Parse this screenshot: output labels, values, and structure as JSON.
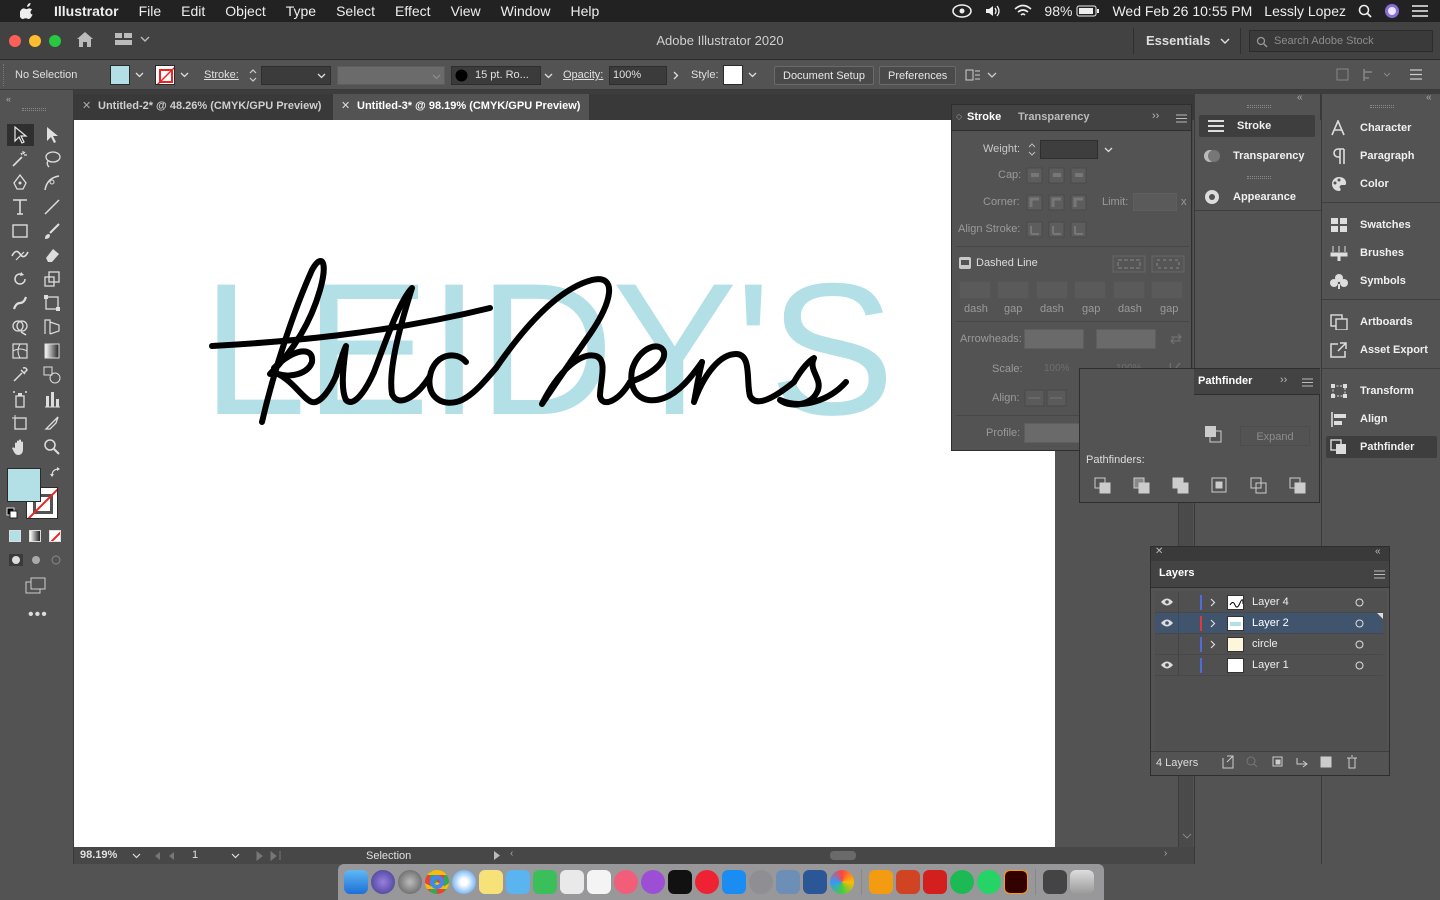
{
  "menubar": {
    "apple": "",
    "items": [
      "Illustrator",
      "File",
      "Edit",
      "Object",
      "Type",
      "Select",
      "Effect",
      "View",
      "Window",
      "Help"
    ],
    "battery": "98%",
    "datetime": "Wed Feb 26  10:55 PM",
    "user": "Lessly Lopez"
  },
  "titlebar": {
    "title": "Adobe Illustrator 2020",
    "workspace": "Essentials",
    "search_placeholder": "Search Adobe Stock"
  },
  "control": {
    "selection": "No Selection",
    "stroke_label": "Stroke:",
    "brush": "15 pt. Ro...",
    "opacity_label": "Opacity:",
    "opacity": "100%",
    "style_label": "Style:",
    "doc_setup": "Document Setup",
    "preferences": "Preferences"
  },
  "tabs": [
    {
      "label": "Untitled-2* @ 48.26% (CMYK/GPU Preview)"
    },
    {
      "label": "Untitled-3* @ 98.19% (CMYK/GPU Preview)"
    }
  ],
  "artwork": {
    "back_text": "LEIDY'S",
    "back_color": "#b3e0e6",
    "script_text": "kitchen"
  },
  "colors": {
    "fill": "#b3e0e6",
    "stroke": "none"
  },
  "stroke_panel": {
    "tabs": [
      "Stroke",
      "Transparency"
    ],
    "weight": "Weight:",
    "cap": "Cap:",
    "corner": "Corner:",
    "limit": "Limit:",
    "limit_x": "x",
    "align_stroke": "Align Stroke:",
    "dashed": "Dashed Line",
    "dash_labels": [
      "dash",
      "gap",
      "dash",
      "gap",
      "dash",
      "gap"
    ],
    "arrowheads": "Arrowheads:",
    "scale": "Scale:",
    "scale_v1": "100%",
    "scale_v2": "100%",
    "align": "Align:",
    "profile": "Profile:"
  },
  "mid_dock": {
    "items": [
      "Stroke",
      "Transparency",
      "Appearance"
    ]
  },
  "pathfinder": {
    "tab": "Pathfinder",
    "expand": "Expand",
    "pathfinders": "Pathfinders:"
  },
  "right_dock": {
    "items": [
      "Character",
      "Paragraph",
      "Color",
      "Swatches",
      "Brushes",
      "Symbols",
      "Artboards",
      "Asset Export",
      "Transform",
      "Align",
      "Pathfinder"
    ]
  },
  "layers": {
    "title": "Layers",
    "rows": [
      {
        "name": "Layer 4",
        "visible": true,
        "color": "#4f6bd9"
      },
      {
        "name": "Layer 2",
        "visible": true,
        "color": "#e0393b"
      },
      {
        "name": "circle",
        "visible": false,
        "color": "#4f6bd9"
      },
      {
        "name": "Layer 1",
        "visible": true,
        "color": "#4f6bd9"
      }
    ],
    "count": "4 Layers"
  },
  "status": {
    "zoom": "98.19%",
    "page": "1",
    "tool": "Selection"
  }
}
